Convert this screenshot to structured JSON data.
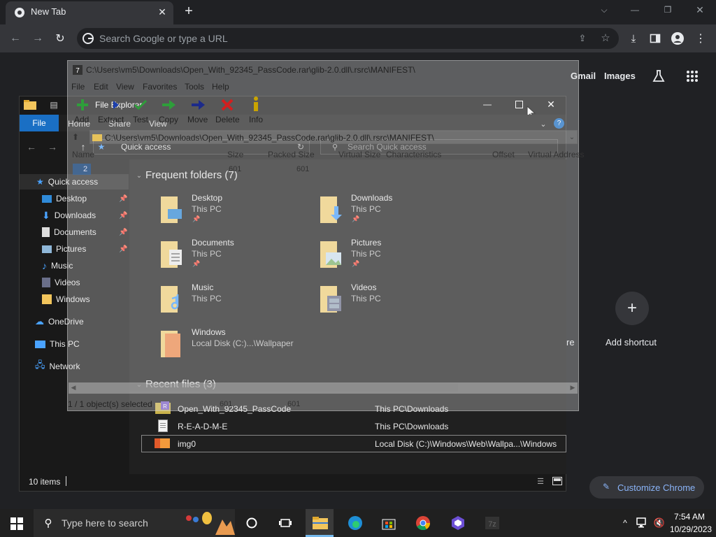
{
  "chrome": {
    "tab_title": "New Tab",
    "omnibox_placeholder": "Search Google or type a URL",
    "ntp_gmail": "Gmail",
    "ntp_images": "Images",
    "add_shortcut": "Add shortcut",
    "customize": "Customize Chrome",
    "partial_text": "re"
  },
  "zip": {
    "title": "C:\\Users\\vm5\\Downloads\\Open_With_92345_PassCode.rar\\glib-2.0.dll\\.rsrc\\MANIFEST\\",
    "menu": [
      "File",
      "Edit",
      "View",
      "Favorites",
      "Tools",
      "Help"
    ],
    "buttons": [
      "Add",
      "Extract",
      "Test",
      "Copy",
      "Move",
      "Delete",
      "Info"
    ],
    "path": "C:\\Users\\vm5\\Downloads\\Open_With_92345_PassCode.rar\\glib-2.0.dll\\.rsrc\\MANIFEST\\",
    "columns": [
      "Name",
      "Size",
      "Packed Size",
      "Virtual Size",
      "Characteristics",
      "Offset",
      "Virtual Address"
    ],
    "row": {
      "name": "2",
      "size": "601",
      "packed": "601"
    },
    "status": "1 / 1 object(s) selected",
    "status_size": "601",
    "status_packed": "601"
  },
  "fe": {
    "title": "File Explorer",
    "file_tab": "File",
    "tabs": [
      "Home",
      "Share",
      "View"
    ],
    "address": "Quick access",
    "search_placeholder": "Search Quick access",
    "sidebar": {
      "quick_access": "Quick access",
      "items": [
        "Desktop",
        "Downloads",
        "Documents",
        "Pictures",
        "Music",
        "Videos",
        "Windows"
      ],
      "onedrive": "OneDrive",
      "thispc": "This PC",
      "network": "Network"
    },
    "frequent_header": "Frequent folders (7)",
    "folders": [
      {
        "name": "Desktop",
        "sub": "This PC"
      },
      {
        "name": "Downloads",
        "sub": "This PC"
      },
      {
        "name": "Documents",
        "sub": "This PC"
      },
      {
        "name": "Pictures",
        "sub": "This PC"
      },
      {
        "name": "Music",
        "sub": "This PC"
      },
      {
        "name": "Videos",
        "sub": "This PC"
      },
      {
        "name": "Windows",
        "sub": "Local Disk (C:)...\\Wallpaper"
      }
    ],
    "recent_header": "Recent files (3)",
    "recent": [
      {
        "name": "Open_With_92345_PassCode",
        "loc": "This PC\\Downloads"
      },
      {
        "name": "R-E-A-D-M-E",
        "loc": "This PC\\Downloads"
      },
      {
        "name": "img0",
        "loc": "Local Disk (C:)\\Windows\\Web\\Wallpa...\\Windows"
      }
    ],
    "status": "10 items"
  },
  "taskbar": {
    "search_placeholder": "Type here to search",
    "time": "7:54 AM",
    "date": "10/29/2023"
  },
  "colors": {
    "accent": "#1a6fc4",
    "chrome_link": "#8ab4f8"
  }
}
